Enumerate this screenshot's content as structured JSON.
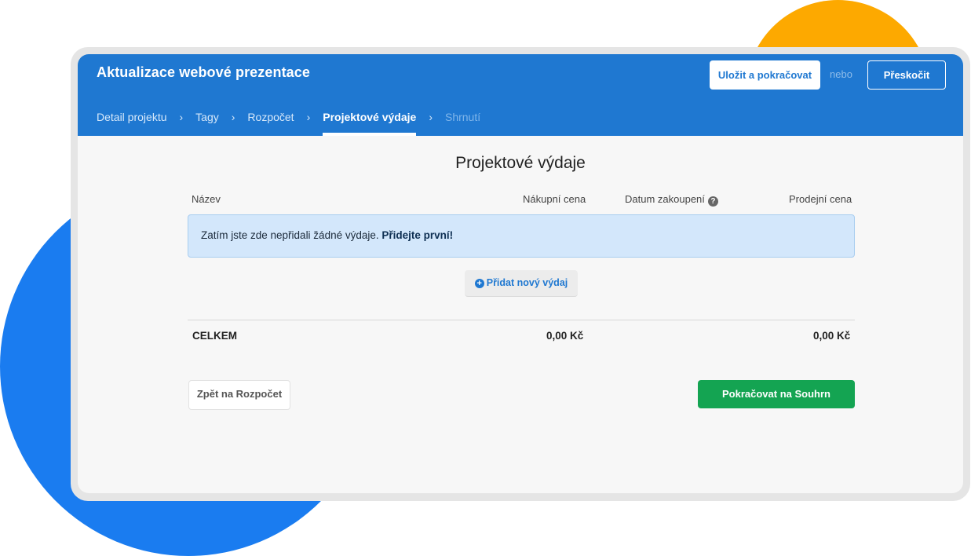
{
  "colors": {
    "header_blue": "#1F78D1",
    "success_green": "#14A452",
    "deco_orange": "#FDA900",
    "deco_blue": "#1A7CF0",
    "info_bg": "#D3E7FB"
  },
  "header": {
    "title": "Aktualizace webové prezentace",
    "save_label": "Uložit a pokračovat",
    "or_text": "nebo",
    "skip_label": "Přeskočit"
  },
  "steps": [
    {
      "label": "Detail projektu",
      "state": "done"
    },
    {
      "label": "Tagy",
      "state": "done"
    },
    {
      "label": "Rozpočet",
      "state": "done"
    },
    {
      "label": "Projektové výdaje",
      "state": "active"
    },
    {
      "label": "Shrnutí",
      "state": "disabled"
    }
  ],
  "step_separator": "›",
  "main": {
    "title": "Projektové výdaje",
    "columns": {
      "name": "Název",
      "purchase_price": "Nákupní cena",
      "purchase_date": "Datum zakoupení",
      "sale_price": "Prodejní cena"
    },
    "help_icon": "?",
    "empty_message": "Zatím jste zde nepřidali žádné výdaje.",
    "empty_cta": "Přidejte první!",
    "add_icon": "+",
    "add_label": "Přidat nový výdaj",
    "total_label": "CELKEM",
    "total_purchase": "0,00 Kč",
    "total_sale": "0,00 Kč"
  },
  "footer": {
    "back_label": "Zpět na Rozpočet",
    "next_label": "Pokračovat na Souhrn"
  }
}
